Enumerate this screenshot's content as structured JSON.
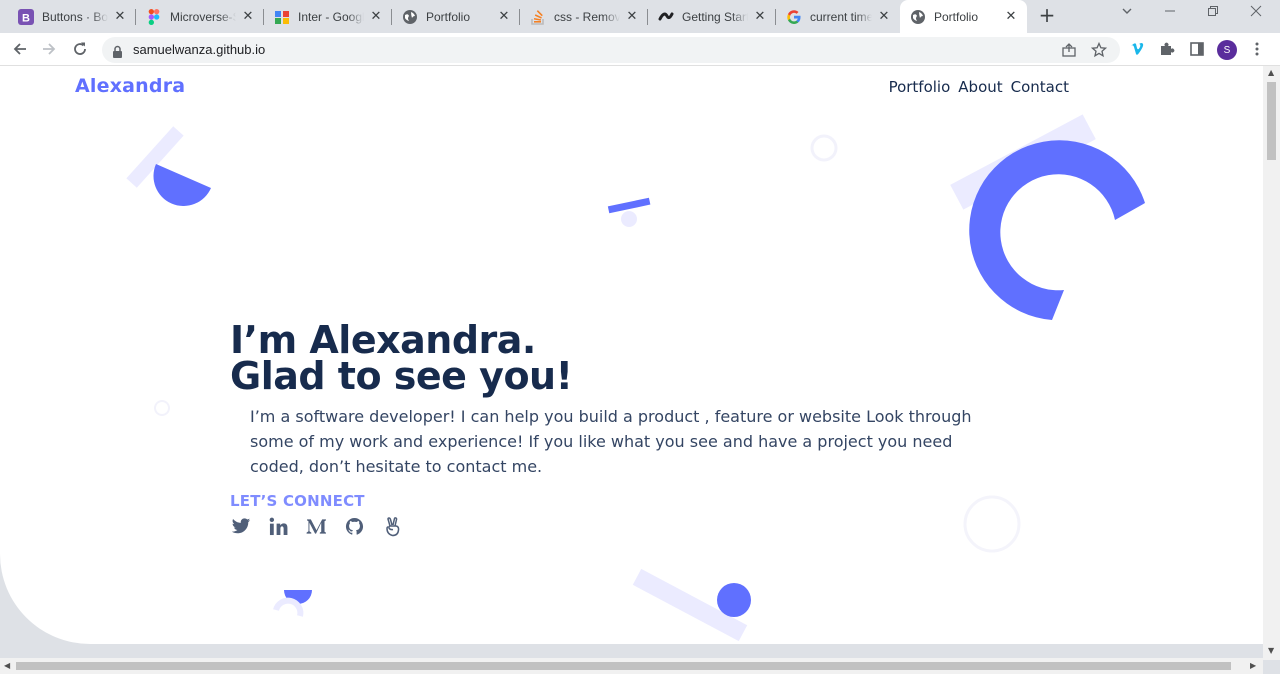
{
  "browser": {
    "tabs": [
      {
        "title": "Buttons · Bootstrap",
        "favicon": "bootstrap-icon",
        "active": false
      },
      {
        "title": "Microverse-Snapshoot",
        "favicon": "figma-icon",
        "active": false
      },
      {
        "title": "Inter - Google Fonts",
        "favicon": "google-fonts-icon",
        "active": false
      },
      {
        "title": "Portfolio",
        "favicon": "globe-icon",
        "active": false
      },
      {
        "title": "css - Remove",
        "favicon": "stackoverflow-icon",
        "active": false
      },
      {
        "title": "Getting Started",
        "favicon": "getting-started-icon",
        "active": false
      },
      {
        "title": "current time",
        "favicon": "google-icon",
        "active": false
      },
      {
        "title": "Portfolio",
        "favicon": "globe-icon",
        "active": true
      }
    ],
    "close_glyph": "✕",
    "new_tab_glyph": "+",
    "url": "samuelwanza.github.io",
    "profile_initial": "S",
    "accent_colors": {
      "bootstrap": "#7952b3",
      "profile": "#5a2d9c",
      "vimeo": "#1ab7ea"
    }
  },
  "page": {
    "logo": "Alexandra",
    "nav": [
      "Portfolio",
      "About",
      "Contact"
    ],
    "headline_line1": "I’m Alexandra.",
    "headline_line2": "Glad to see you!",
    "intro": "I’m a software developer! I can help you build a product , feature or website Look through some of my work and experience! If you like what you see and have a project you need coded, don’t hesitate to contact me.",
    "connect_label": "LET’S CONNECT",
    "socials": [
      "twitter-icon",
      "linkedin-icon",
      "medium-icon",
      "github-icon",
      "angellist-icon"
    ],
    "colors": {
      "primary": "#6070ff",
      "heading": "#172b4d",
      "body": "#344563",
      "light_shape": "#ebebff",
      "connect": "#7f8cff"
    }
  }
}
